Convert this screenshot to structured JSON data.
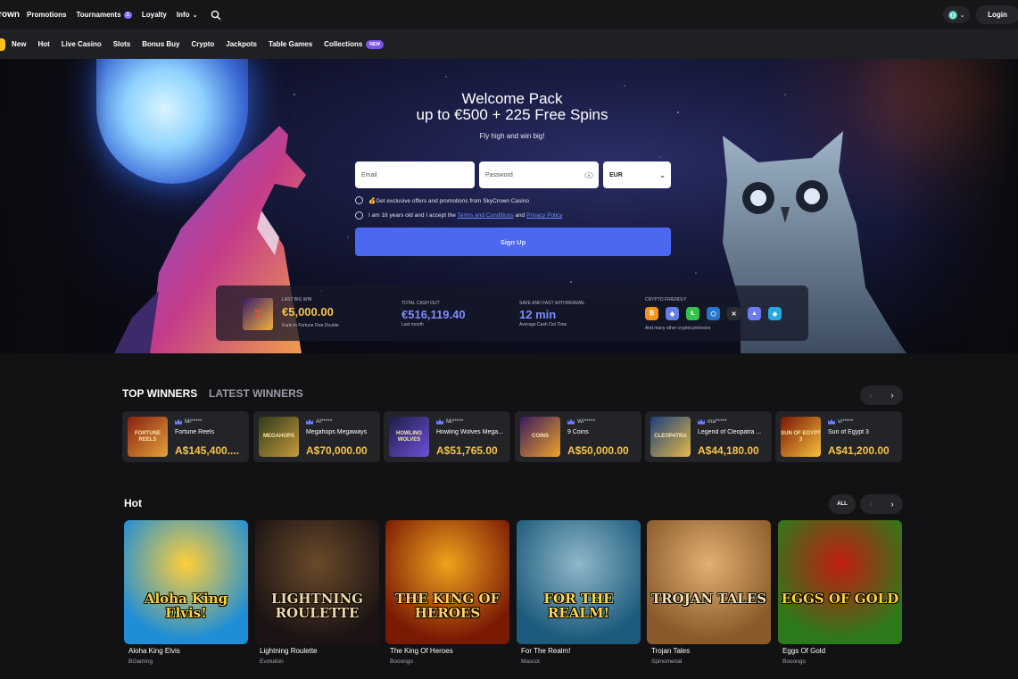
{
  "header": {
    "logo": "SkyCrown",
    "nav": [
      {
        "label": "Promotions"
      },
      {
        "label": "Tournaments",
        "badge": "1"
      },
      {
        "label": "Loyalty"
      },
      {
        "label": "Info"
      }
    ],
    "login_label": "Login"
  },
  "categories": [
    "New",
    "Hot",
    "Live Casino",
    "Slots",
    "Bonus Buy",
    "Crypto",
    "Jackpots",
    "Table Games",
    "Collections"
  ],
  "categories_new_badge": "NEW",
  "hero": {
    "title_line1": "Welcome Pack",
    "title_line2": "up to €500 + 225 Free Spins",
    "subtitle": "Fly high and win big!",
    "email_placeholder": "Email",
    "password_placeholder": "Password",
    "currency": "EUR",
    "offers_text": "💰Get exclusive offers and promotions from SkyCrown Casino",
    "age_text_pre": "I am 18 years old and I accept the",
    "terms_link": "Terms and Conditions",
    "and_text": "and",
    "privacy_link": "Privacy Policy",
    "signup_label": "Sign Up"
  },
  "stats": {
    "last_win_label": "LAST BIG WIN",
    "last_win_value": "€5,000.00",
    "last_win_note": "Karin in Fortune Five Double",
    "total_label": "TOTAL CASH OUT",
    "total_value": "€516,119.40",
    "total_note": "Last month",
    "withdraw_label": "SAFE AND FAST WITHDRAWAL",
    "withdraw_value": "12 min",
    "withdraw_note": "Average Cash Out Time",
    "crypto_label": "CRYPTO FRIENDLY",
    "crypto_note": "And many other cryptocurrencies",
    "coins": [
      {
        "symbol": "₿",
        "color": "#f7931a"
      },
      {
        "symbol": "◆",
        "color": "#627eea"
      },
      {
        "symbol": "Ł",
        "color": "#34c24a"
      },
      {
        "symbol": "⬡",
        "color": "#2775ca"
      },
      {
        "symbol": "✕",
        "color": "#2b2c33"
      },
      {
        "symbol": "▲",
        "color": "#6b7bf2"
      },
      {
        "symbol": "◈",
        "color": "#26a9e0"
      }
    ]
  },
  "winners": {
    "tab_top": "TOP WINNERS",
    "tab_latest": "LATEST WINNERS",
    "items": [
      {
        "user": "Mi*****",
        "game": "Fortune Reels",
        "amount": "A$145,400....",
        "art": "#8a1f0e",
        "art2": "#e2a23b",
        "thumb_text": "FORTUNE REELS"
      },
      {
        "user": "Al*****",
        "game": "Megahops Megaways",
        "amount": "A$70,000.00",
        "art": "#2d3b1a",
        "art2": "#c79a3a",
        "thumb_text": "MEGAHOPS"
      },
      {
        "user": "Mi*****",
        "game": "Howling Wolves Mega...",
        "amount": "A$51,765.00",
        "art": "#1b1e4a",
        "art2": "#6f4fd8",
        "thumb_text": "HOWLING WOLVES"
      },
      {
        "user": "Wi*****",
        "game": "9 Coins",
        "amount": "A$50,000.00",
        "art": "#3a1a5e",
        "art2": "#f0a22a",
        "thumb_text": "COINS"
      },
      {
        "user": "ma*****",
        "game": "Legend of Cleopatra ...",
        "amount": "A$44,180.00",
        "art": "#1a3f7a",
        "art2": "#e5b94a",
        "thumb_text": "CLEOPATRA"
      },
      {
        "user": "vi*****",
        "game": "Sun of Egypt 3",
        "amount": "A$41,200.00",
        "art": "#7a1406",
        "art2": "#f8c23a",
        "thumb_text": "SUN OF EGYPT 3"
      }
    ]
  },
  "hot": {
    "title": "Hot",
    "all_label": "ALL",
    "games": [
      {
        "name": "Aloha King Elvis",
        "provider": "BGaming",
        "logo": "Aloha King Elvis!",
        "c1": "#1e8ed6",
        "c2": "#ffcf3a",
        "logo_color": "#ffd23a"
      },
      {
        "name": "Lightning Roulette",
        "provider": "Evolution",
        "logo": "LIGHTNING ROULETTE",
        "c1": "#1c1414",
        "c2": "#6a4a2a",
        "logo_color": "#f1d9a8"
      },
      {
        "name": "The King Of Heroes",
        "provider": "Booongo",
        "logo": "THE KING OF HEROES",
        "c1": "#7a1a05",
        "c2": "#f0a31c",
        "logo_color": "#ffd36a"
      },
      {
        "name": "For The Realm!",
        "provider": "Mascot",
        "logo": "FOR THE REALM!",
        "c1": "#1d5b7c",
        "c2": "#8fb7c9",
        "logo_color": "#ffd84a"
      },
      {
        "name": "Trojan Tales",
        "provider": "Spinomenal",
        "logo": "TROJAN TALES",
        "c1": "#8a5a2a",
        "c2": "#e0b071",
        "logo_color": "#f3e0b0"
      },
      {
        "name": "Eggs Of Gold",
        "provider": "Booongo",
        "logo": "EGGS OF GOLD",
        "c1": "#2d7a1a",
        "c2": "#c21d12",
        "logo_color": "#ffd13a"
      }
    ]
  }
}
